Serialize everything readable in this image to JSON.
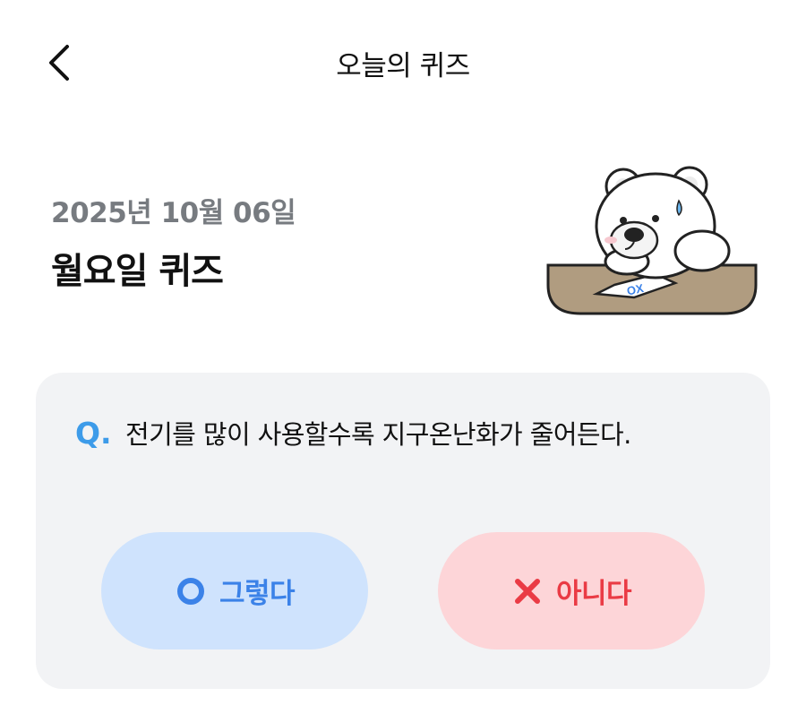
{
  "header": {
    "title": "오늘의 퀴즈",
    "back_icon": "chevron-left-icon"
  },
  "quiz": {
    "date": "2025년 10월 06일",
    "title": "월요일 퀴즈",
    "question_prefix": "Q.",
    "question": "전기를 많이 사용할수록 지구온난화가 줄어든다."
  },
  "mascot": {
    "sheet_text": "OX"
  },
  "answers": {
    "yes_label": "그렇다",
    "yes_icon": "circle-o-icon",
    "no_label": "아니다",
    "no_icon": "x-mark-icon"
  },
  "colors": {
    "accent_blue": "#3d9be9",
    "yes_bg": "#cfe3fd",
    "yes_fg": "#3b82e8",
    "no_bg": "#fdd5d8",
    "no_fg": "#ea3b45",
    "card_bg": "#f2f3f5"
  }
}
